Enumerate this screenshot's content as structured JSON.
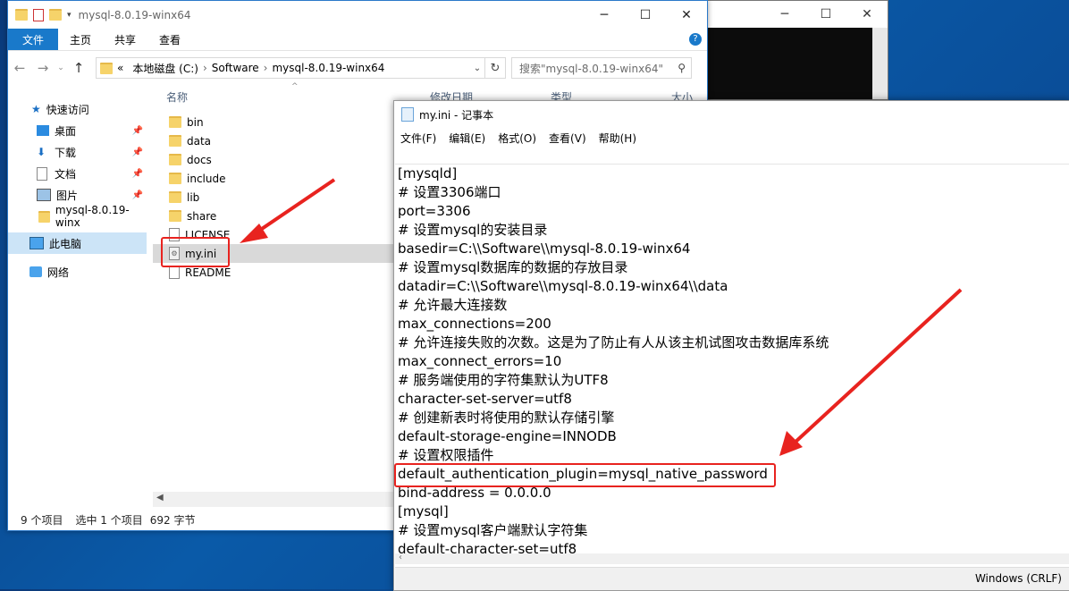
{
  "cmd_window": {
    "minimize": "─",
    "maximize": "☐",
    "close": "✕"
  },
  "explorer": {
    "title": "mysql-8.0.19-winx64",
    "window_buttons": {
      "minimize": "─",
      "maximize": "☐",
      "close": "✕"
    },
    "ribbon_tabs": [
      "文件",
      "主页",
      "共享",
      "查看"
    ],
    "help": "?",
    "address": {
      "prefix": "«",
      "crumbs": [
        "本地磁盘 (C:)",
        "Software",
        "mysql-8.0.19-winx64"
      ]
    },
    "search_placeholder": "搜索\"mysql-8.0.19-winx64\"",
    "nav_pane": [
      {
        "label": "快速访问",
        "icon": "star-icon"
      },
      {
        "label": "桌面",
        "icon": "desktop-icon",
        "pinned": true
      },
      {
        "label": "下载",
        "icon": "download-icon",
        "pinned": true
      },
      {
        "label": "文档",
        "icon": "document-icon",
        "pinned": true
      },
      {
        "label": "图片",
        "icon": "picture-icon",
        "pinned": true
      },
      {
        "label": "mysql-8.0.19-winx",
        "icon": "folder-icon"
      },
      {
        "label": "此电脑",
        "icon": "computer-icon"
      },
      {
        "label": "网络",
        "icon": "network-icon"
      }
    ],
    "columns": [
      "名称",
      "修改日期",
      "类型",
      "大小"
    ],
    "files": [
      {
        "name": "bin",
        "kind": "folder"
      },
      {
        "name": "data",
        "kind": "folder"
      },
      {
        "name": "docs",
        "kind": "folder"
      },
      {
        "name": "include",
        "kind": "folder"
      },
      {
        "name": "lib",
        "kind": "folder"
      },
      {
        "name": "share",
        "kind": "folder"
      },
      {
        "name": "LICENSE",
        "kind": "file"
      },
      {
        "name": "my.ini",
        "kind": "config",
        "selected": true
      },
      {
        "name": "README",
        "kind": "file"
      }
    ],
    "status": {
      "items": "9 个项目",
      "selected": "选中 1 个项目",
      "size": "692 字节"
    }
  },
  "notepad": {
    "title": "my.ini - 记事本",
    "window_buttons": {
      "minimize": "─",
      "maximize": "☐",
      "close": "✕"
    },
    "menu": [
      "文件(F)",
      "编辑(E)",
      "格式(O)",
      "查看(V)",
      "帮助(H)"
    ],
    "lines": [
      "[mysqld]",
      "# 设置3306端口",
      "port=3306",
      "# 设置mysql的安装目录",
      "basedir=C:\\\\Software\\\\mysql-8.0.19-winx64",
      "# 设置mysql数据库的数据的存放目录",
      "datadir=C:\\\\Software\\\\mysql-8.0.19-winx64\\\\data",
      "# 允许最大连接数",
      "max_connections=200",
      "# 允许连接失败的次数。这是为了防止有人从该主机试图攻击数据库系统",
      "max_connect_errors=10",
      "# 服务端使用的字符集默认为UTF8",
      "character-set-server=utf8",
      "# 创建新表时将使用的默认存储引擎",
      "default-storage-engine=INNODB",
      "# 设置权限插件",
      "default_authentication_plugin=mysql_native_password",
      "bind-address = 0.0.0.0",
      "[mysql]",
      "# 设置mysql客户端默认字符集",
      "default-character-set=utf8"
    ],
    "encoding": "Windows (CRLF)"
  },
  "annotation_color": "#e8231f"
}
